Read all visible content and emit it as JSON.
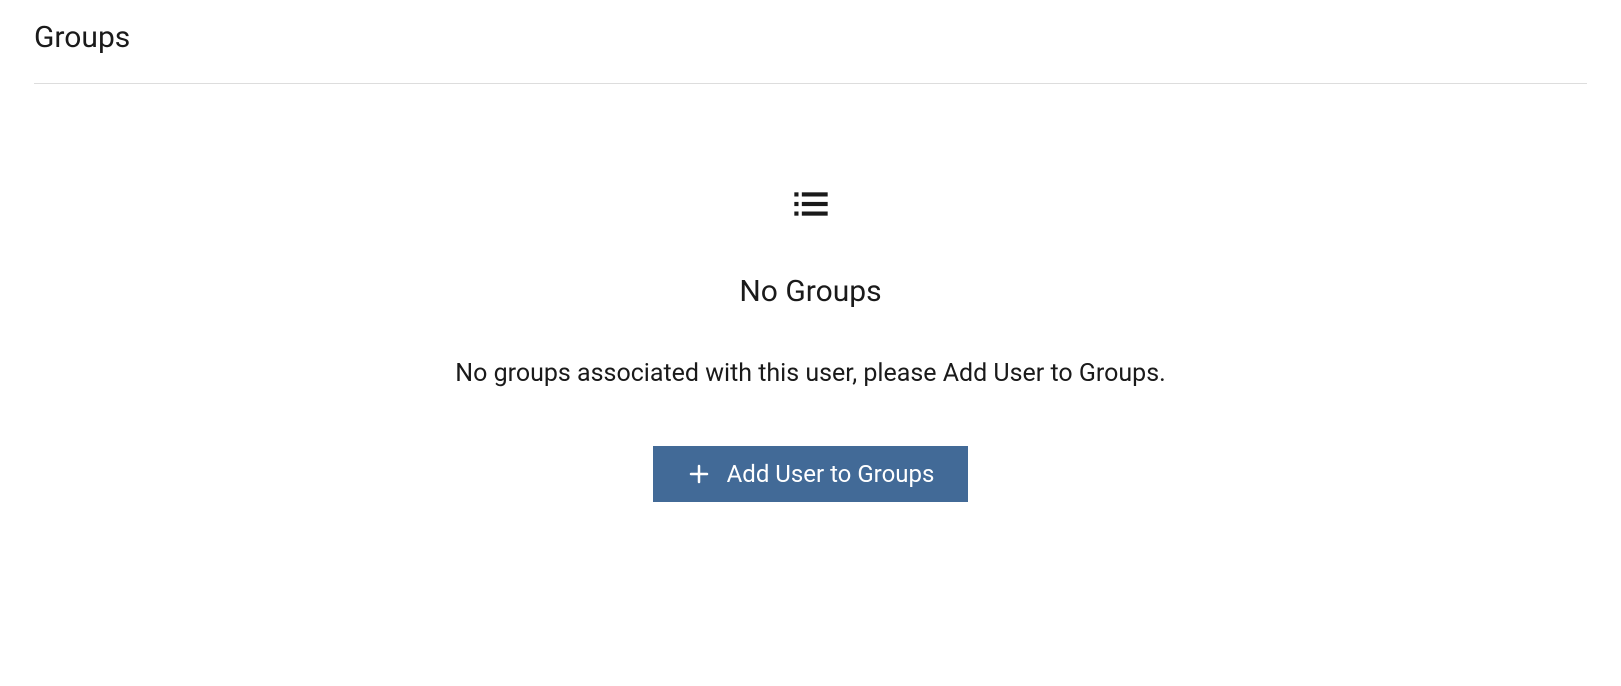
{
  "section": {
    "title": "Groups"
  },
  "emptyState": {
    "title": "No Groups",
    "description": "No groups associated with this user, please Add User to Groups.",
    "button_label": "Add User to Groups"
  }
}
